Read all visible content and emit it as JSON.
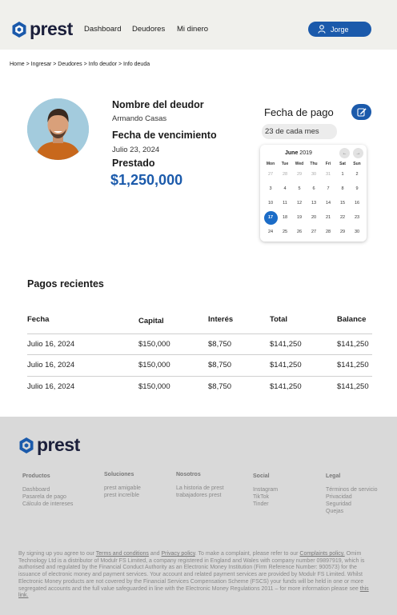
{
  "brand": {
    "name": "prest",
    "color": "#1b5aab"
  },
  "nav": {
    "items": [
      "Dashboard",
      "Deudores",
      "Mi dinero"
    ]
  },
  "user": {
    "name": "Jorge",
    "icon": "user-icon"
  },
  "breadcrumb": "Home > Ingresar > Deudores > Info deudor > Info deuda",
  "debtor": {
    "name_label": "Nombre del deudor",
    "name": "Armando Casas",
    "due_label": "Fecha de vencimiento",
    "due_date": "Julio 23, 2024",
    "lent_label": "Prestado",
    "lent_amount": "$1,250,000"
  },
  "payment_date": {
    "title": "Fecha de pago",
    "value": "23 de cada mes",
    "edit_icon": "edit-icon"
  },
  "calendar": {
    "month": "June",
    "year": "2019",
    "prev": "←",
    "next": "→",
    "weekdays": [
      "Mon",
      "Tue",
      "Wed",
      "Thu",
      "Fri",
      "Sat",
      "Sun"
    ],
    "weeks": [
      [
        "27",
        "28",
        "29",
        "30",
        "31",
        "1",
        "2"
      ],
      [
        "3",
        "4",
        "5",
        "6",
        "7",
        "8",
        "9"
      ],
      [
        "10",
        "11",
        "12",
        "13",
        "14",
        "15",
        "16"
      ],
      [
        "17",
        "18",
        "19",
        "20",
        "21",
        "22",
        "23"
      ],
      [
        "24",
        "25",
        "26",
        "27",
        "28",
        "29",
        "30"
      ]
    ],
    "selected": "17",
    "selected_color": "#1b6cc7"
  },
  "payments": {
    "title": "Pagos recientes",
    "columns": [
      "Fecha",
      "Capital",
      "Interés",
      "Total",
      "Balance"
    ],
    "rows": [
      [
        "Julio 16, 2024",
        "$150,000",
        "$8,750",
        "$141,250",
        "$141,250"
      ],
      [
        "Julio 16, 2024",
        "$150,000",
        "$8,750",
        "$141,250",
        "$141,250"
      ],
      [
        "Julio 16, 2024",
        "$150,000",
        "$8,750",
        "$141,250",
        "$141,250"
      ]
    ]
  },
  "footer": {
    "columns": [
      {
        "title": "Productos",
        "links": [
          "Dashboard",
          "Pasarela de pago",
          "Cálculo de intereses"
        ]
      },
      {
        "title": "Soluciones",
        "links": [
          "prest amigable",
          "prest increíble"
        ]
      },
      {
        "title": "Nosotros",
        "links": [
          "La historia de prest",
          "trabajadores prest"
        ]
      },
      {
        "title": "Social",
        "links": [
          "Instagram",
          "TikTok",
          "Tinder"
        ]
      },
      {
        "title": "Legal",
        "links": [
          "Términos de servicio",
          "Privacidad",
          "Seguridad",
          "Quejas"
        ]
      }
    ],
    "legal": {
      "p1": "By signing up you agree to our ",
      "terms": "Terms and conditions",
      "and": " and ",
      "privacy": "Privacy policy",
      "p2": ". To make a complaint, please refer to our ",
      "complaints": "Complaints policy.",
      "p3": " Omim Technology Ltd is a distributor of Modulr FS Limited, a company registered in England and Wales with company number 09897919, which is authorised and regulated by the Financial Conduct Authority as an Electronic Money Institution (Firm Reference Number: 900573) for the issuance of electronic money and payment services. Your account and related payment services are provided by Modulr FS Limited. Whilst Electronic Money products are not covered by the Financial Services Compensation Scheme (FSCS) your funds will be held in one or more segregated accounts and the full value safeguarded in line with the Electronic Money Regulations 2011 – for more information please see ",
      "link": "this link."
    }
  }
}
